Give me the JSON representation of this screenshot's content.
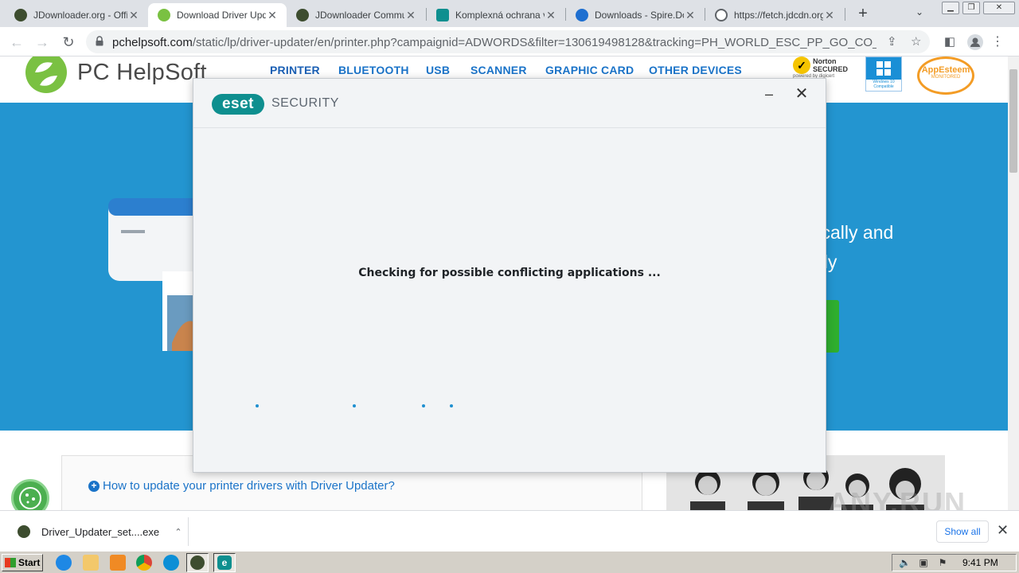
{
  "browser": {
    "tabs": [
      {
        "title": "JDownloader.org - Offi",
        "favicon_color": "#3d4d2f",
        "active": false
      },
      {
        "title": "Download Driver Updat",
        "favicon_color": "#7ac142",
        "active": true
      },
      {
        "title": "JDownloader Communi",
        "favicon_color": "#3d4d2f",
        "active": false
      },
      {
        "title": "Komplexná ochrana vá",
        "favicon_color": "#0e8f8f",
        "active": false
      },
      {
        "title": "Downloads - Spire.Doc",
        "favicon_color": "#1e6fd0",
        "active": false
      },
      {
        "title": "https://fetch.jdcdn.org",
        "favicon_color": "#5f6368",
        "active": false
      }
    ],
    "new_tab_label": "+",
    "url_main": "pchelpsoft.com",
    "url_rest": "/static/lp/driver-updater/en/printer.php?campaignid=ADWORDS&filter=130619498128&tracking=PH_WORLD_ESC_PP_GO_CO_DU&gclid..."
  },
  "site": {
    "logo_text": "PC HelpSoft",
    "nav": [
      "PRINTER",
      "BLUETOOTH",
      "USB",
      "SCANNER",
      "GRAPHIC CARD",
      "OTHER DEVICES"
    ],
    "badges": {
      "norton": "Norton SECURED",
      "norton_sub": "powered by digicert",
      "windows": "Windows 10 Compatible",
      "appesteem": "AppEsteem",
      "appesteem_sub": "MONITORED"
    },
    "hero_line1": "tically and",
    "hero_line2": "nly",
    "faq_link": "How to update your printer drivers with Driver Updater?",
    "watermark": "ANY.RUN"
  },
  "eset": {
    "logo": "eset",
    "product": "SECURITY",
    "status": "Checking for possible conflicting applications ...",
    "minimize": "–",
    "close": "✕"
  },
  "downloads": {
    "file": "Driver_Updater_set....exe",
    "show_all": "Show all"
  },
  "taskbar": {
    "start": "Start",
    "clock": "9:41 PM"
  }
}
